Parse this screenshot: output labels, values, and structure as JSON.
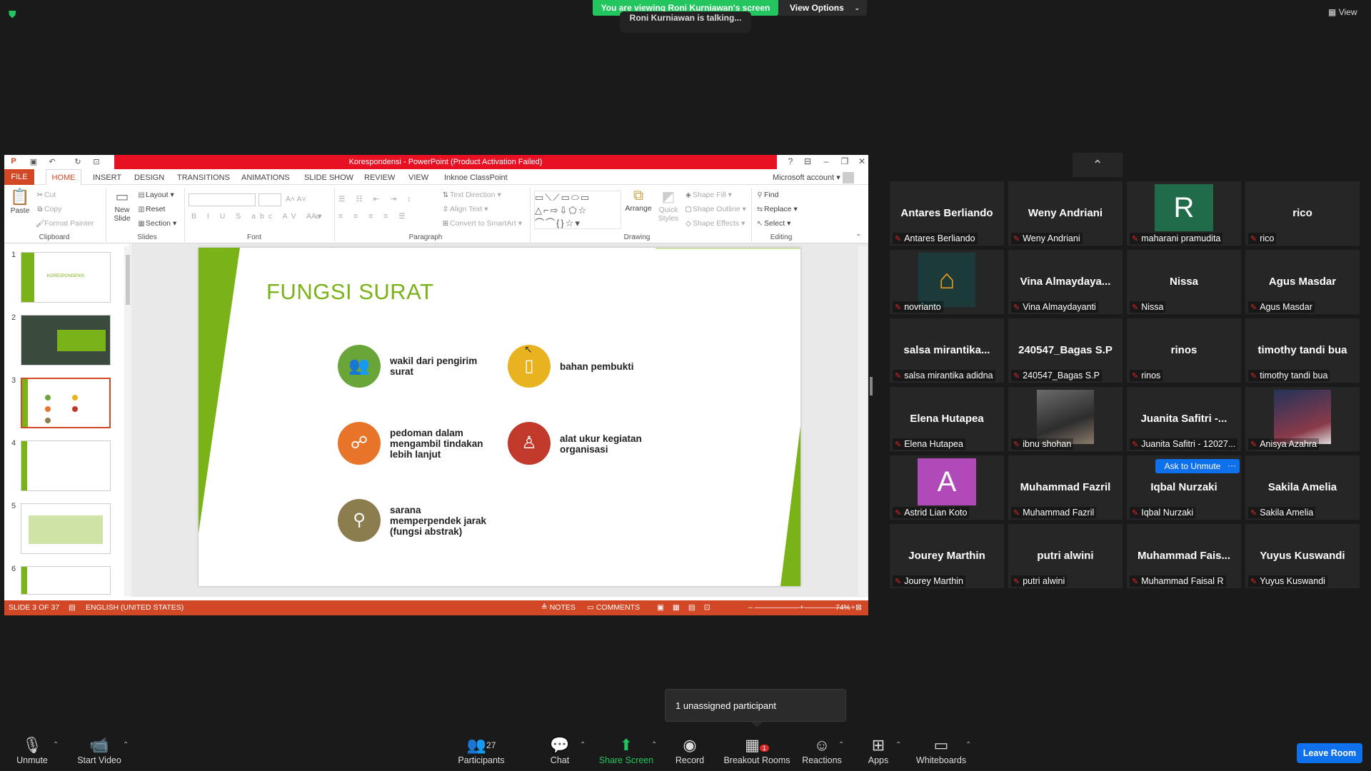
{
  "banner": {
    "viewing": "You are viewing Roni Kurniawan's screen",
    "view_options": "View Options",
    "talking": "Roni Kurniawan is talking...",
    "view": "View"
  },
  "ppt": {
    "title": "Korespondensi - PowerPoint (Product Activation Failed)",
    "tabs": [
      "FILE",
      "HOME",
      "INSERT",
      "DESIGN",
      "TRANSITIONS",
      "ANIMATIONS",
      "SLIDE SHOW",
      "REVIEW",
      "VIEW",
      "Inknoe ClassPoint"
    ],
    "account": "Microsoft account",
    "clipboard": {
      "paste": "Paste",
      "cut": "Cut",
      "copy": "Copy",
      "format_painter": "Format Painter",
      "label": "Clipboard"
    },
    "slides_group": {
      "new_slide": "New Slide",
      "layout": "Layout",
      "reset": "Reset",
      "section": "Section",
      "label": "Slides"
    },
    "font_group": {
      "label": "Font"
    },
    "paragraph_group": {
      "text_direction": "Text Direction",
      "align_text": "Align Text",
      "convert_smartart": "Convert to SmartArt",
      "label": "Paragraph"
    },
    "drawing_group": {
      "arrange": "Arrange",
      "quick_styles": "Quick Styles",
      "shape_fill": "Shape Fill",
      "shape_outline": "Shape Outline",
      "shape_effects": "Shape Effects",
      "label": "Drawing"
    },
    "editing_group": {
      "find": "Find",
      "replace": "Replace",
      "select": "Select",
      "label": "Editing"
    },
    "thumbnails": [
      {
        "num": "1",
        "text": "KORESPONDENSI"
      },
      {
        "num": "2",
        "text": ""
      },
      {
        "num": "3",
        "text": ""
      },
      {
        "num": "4",
        "text": ""
      },
      {
        "num": "5",
        "text": ""
      },
      {
        "num": "6",
        "text": ""
      }
    ],
    "slide": {
      "title": "FUNGSI SURAT",
      "items": [
        {
          "text": "wakil dari pengirim surat",
          "color": "#6aa53a"
        },
        {
          "text": "bahan pembukti",
          "color": "#e9b21f"
        },
        {
          "text": "pedoman dalam mengambil tindakan lebih lanjut",
          "color": "#e8742a"
        },
        {
          "text": "alat ukur kegiatan organisasi",
          "color": "#c0392b"
        },
        {
          "text": "sarana memperpendek jarak (fungsi abstrak)",
          "color": "#8b7d4e"
        }
      ]
    },
    "status": {
      "slide_of": "SLIDE 3 OF 37",
      "language": "ENGLISH (UNITED STATES)",
      "notes": "NOTES",
      "comments": "COMMENTS",
      "zoom": "74%"
    }
  },
  "participants": [
    {
      "center": "Antares Berliando",
      "label": "Antares Berliando"
    },
    {
      "center": "Weny Andriani",
      "label": "Weny Andriani"
    },
    {
      "center": "R",
      "label": "maharani pramudita",
      "avatar_color": "#1f6b4a"
    },
    {
      "center": "rico",
      "label": "rico"
    },
    {
      "center": "",
      "label": "novrianto",
      "avatar": "logo"
    },
    {
      "center": "Vina Almaydaya...",
      "label": "Vina Almaydayanti"
    },
    {
      "center": "Nissa",
      "label": "Nissa"
    },
    {
      "center": "Agus Masdar",
      "label": "Agus Masdar"
    },
    {
      "center": "salsa mirantika...",
      "label": "salsa mirantika adidna"
    },
    {
      "center": "240547_Bagas S.P",
      "label": "240547_Bagas S.P"
    },
    {
      "center": "rinos",
      "label": "rinos"
    },
    {
      "center": "timothy tandi bua",
      "label": "timothy tandi bua"
    },
    {
      "center": "Elena Hutapea",
      "label": "Elena Hutapea"
    },
    {
      "center": "",
      "label": "ibnu shohan",
      "avatar": "photo"
    },
    {
      "center": "Juanita Safitri -...",
      "label": "Juanita Safitri - 12027..."
    },
    {
      "center": "",
      "label": "Anisya Azahra",
      "avatar": "photo2"
    },
    {
      "center": "A",
      "label": "Astrid Lian Koto",
      "avatar_color": "#b04ab8"
    },
    {
      "center": "Muhammad Fazril",
      "label": "Muhammad Fazril"
    },
    {
      "center": "Iqbal Nurzaki",
      "label": "Iqbal Nurzaki"
    },
    {
      "center": "Sakila Amelia",
      "label": "Sakila Amelia"
    },
    {
      "center": "Jourey Marthin",
      "label": "Jourey Marthin"
    },
    {
      "center": "putri alwini",
      "label": "putri alwini"
    },
    {
      "center": "Muhammad Fais...",
      "label": "Muhammad Faisal R"
    },
    {
      "center": "Yuyus Kuswandi",
      "label": "Yuyus Kuswandi"
    }
  ],
  "ask_unmute": "Ask to Unmute",
  "more": "···",
  "tooltip": "1 unassigned participant",
  "toolbar": {
    "unmute": "Unmute",
    "start_video": "Start Video",
    "participants": "Participants",
    "participants_count": "27",
    "chat": "Chat",
    "share_screen": "Share Screen",
    "record": "Record",
    "breakout_rooms": "Breakout Rooms",
    "breakout_badge": "1",
    "reactions": "Reactions",
    "apps": "Apps",
    "whiteboards": "Whiteboards",
    "leave_room": "Leave Room"
  }
}
